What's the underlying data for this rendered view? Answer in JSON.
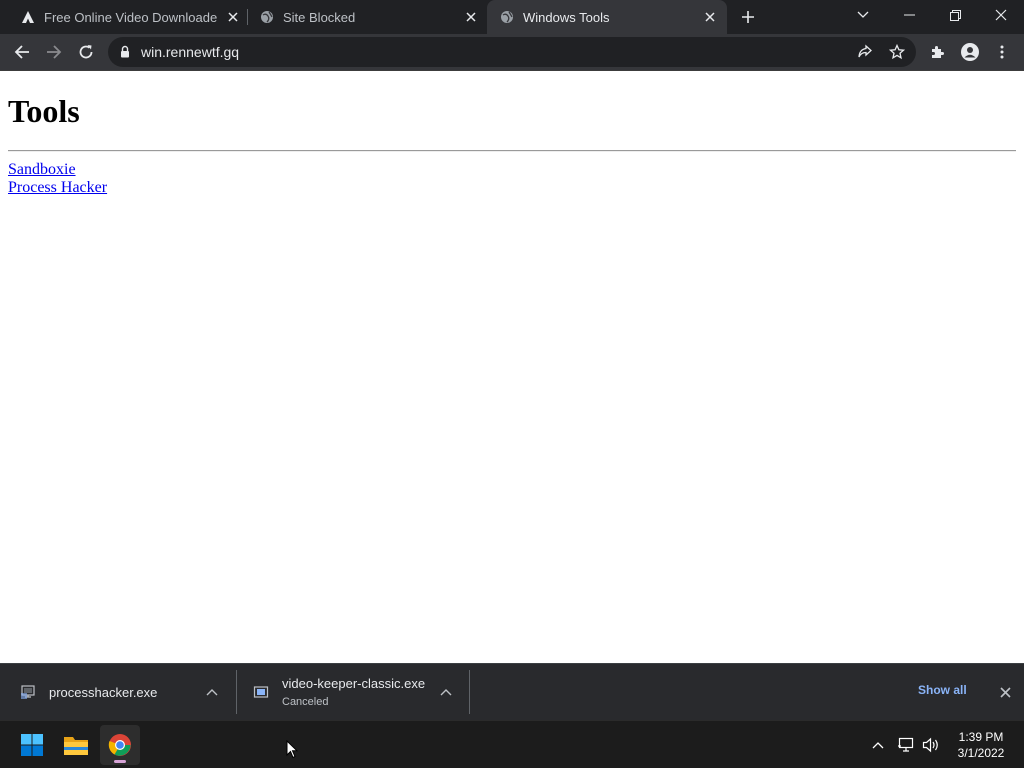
{
  "browser": {
    "tabs": [
      {
        "title": "Free Online Video Downloader -",
        "active": false
      },
      {
        "title": "Site Blocked",
        "active": false
      },
      {
        "title": "Windows Tools",
        "active": true
      }
    ],
    "url": "win.rennewtf.gq"
  },
  "page": {
    "heading": "Tools",
    "links": [
      "Sandboxie",
      "Process Hacker"
    ]
  },
  "downloads": {
    "items": [
      {
        "name": "processhacker.exe",
        "status": ""
      },
      {
        "name": "video-keeper-classic.exe",
        "status": "Canceled"
      }
    ],
    "show_all": "Show all"
  },
  "taskbar": {
    "time": "1:39 PM",
    "date": "3/1/2022"
  },
  "colors": {
    "tab_bg": "#202124",
    "toolbar_bg": "#35363a",
    "link": "#0000ee",
    "show_all": "#8ab4f8",
    "taskbar_bg": "#1c1c1c"
  }
}
